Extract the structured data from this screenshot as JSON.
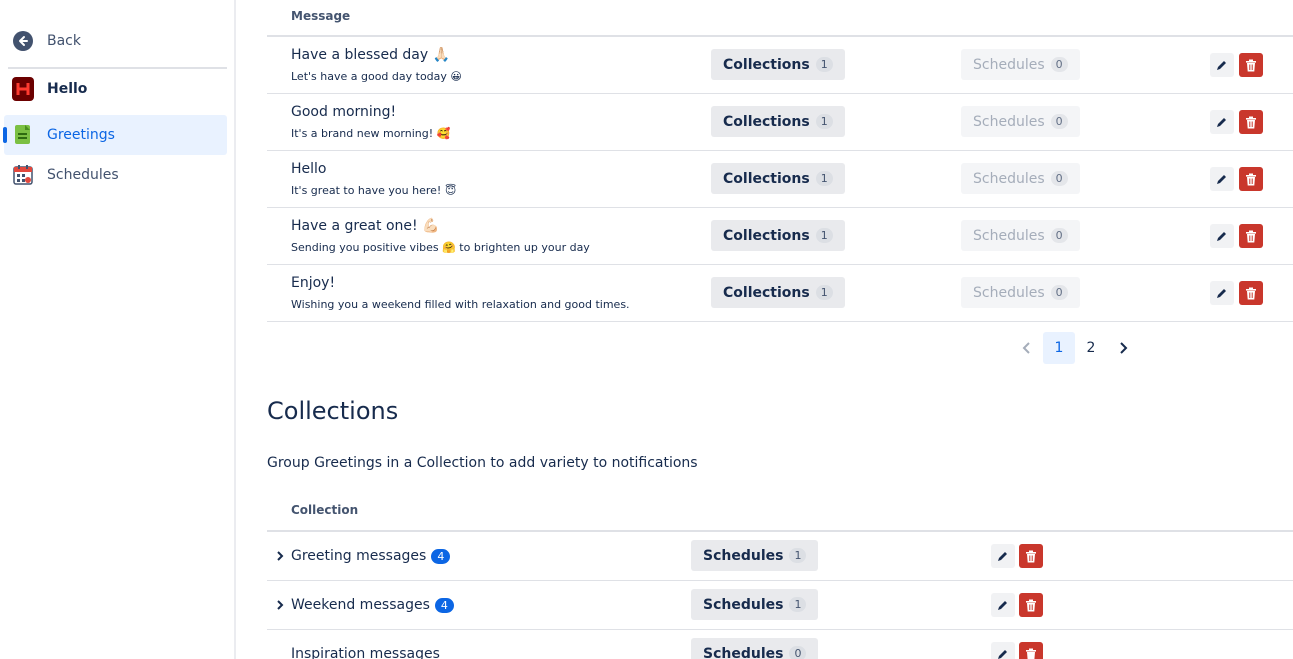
{
  "sidebar": {
    "back_label": "Back",
    "app_name": "Hello",
    "items": [
      {
        "label": "Greetings",
        "icon": "greetings-icon",
        "active": true
      },
      {
        "label": "Schedules",
        "icon": "calendar-icon",
        "active": false
      }
    ]
  },
  "greetings_table": {
    "header": "Message",
    "rows": [
      {
        "title": "Have a blessed day 🙏🏻",
        "subtitle": "Let's have a good day today 😀",
        "collections_label": "Collections",
        "collections_count": "1",
        "schedules_label": "Schedules",
        "schedules_count": "0"
      },
      {
        "title": "Good morning!",
        "subtitle": "It's a brand new morning! 🥰",
        "collections_label": "Collections",
        "collections_count": "1",
        "schedules_label": "Schedules",
        "schedules_count": "0"
      },
      {
        "title": "Hello",
        "subtitle": "It's great to have you here! 😇",
        "collections_label": "Collections",
        "collections_count": "1",
        "schedules_label": "Schedules",
        "schedules_count": "0"
      },
      {
        "title": "Have a great one! 💪🏻",
        "subtitle": "Sending you positive vibes 🤗 to brighten up your day",
        "collections_label": "Collections",
        "collections_count": "1",
        "schedules_label": "Schedules",
        "schedules_count": "0"
      },
      {
        "title": "Enjoy!",
        "subtitle": "Wishing you a weekend filled with relaxation and good times.",
        "collections_label": "Collections",
        "collections_count": "1",
        "schedules_label": "Schedules",
        "schedules_count": "0"
      }
    ],
    "pagination": {
      "pages": [
        "1",
        "2"
      ],
      "current": "1"
    }
  },
  "collections": {
    "heading": "Collections",
    "description": "Group Greetings in a Collection to add variety to notifications",
    "header": "Collection",
    "rows": [
      {
        "name": "Greeting messages",
        "badge": "4",
        "expandable": true,
        "schedules_label": "Schedules",
        "schedules_count": "1"
      },
      {
        "name": "Weekend messages",
        "badge": "4",
        "expandable": true,
        "schedules_label": "Schedules",
        "schedules_count": "1"
      },
      {
        "name": "Inspiration messages",
        "badge": "",
        "expandable": false,
        "schedules_label": "Schedules",
        "schedules_count": "0"
      }
    ]
  },
  "colors": {
    "accent": "#0c66e4",
    "danger": "#c9372c",
    "text": "#172b4d",
    "selected_bg": "#e9f2ff"
  }
}
